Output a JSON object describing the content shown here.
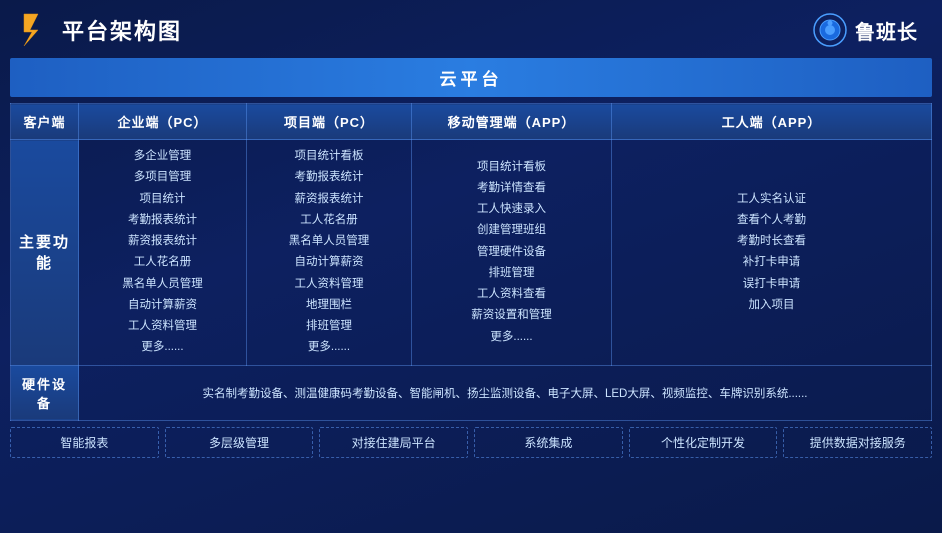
{
  "header": {
    "title": "平台架构图",
    "brand": "鲁班长"
  },
  "cloud": {
    "label": "云平台"
  },
  "columns": {
    "headers": [
      "客户端",
      "企业端（PC）",
      "项目端（PC）",
      "移动管理端（APP）",
      "工人端（APP）"
    ]
  },
  "rows": {
    "main_function_label": "主要功能",
    "enterprise_pc": [
      "多企业管理",
      "多项目管理",
      "项目统计",
      "考勤报表统计",
      "薪资报表统计",
      "工人花名册",
      "黑名单人员管理",
      "自动计算薪资",
      "工人资料管理",
      "更多......"
    ],
    "project_pc": [
      "项目统计看板",
      "考勤报表统计",
      "薪资报表统计",
      "工人花名册",
      "黑名单人员管理",
      "自动计算薪资",
      "工人资料管理",
      "地理围栏",
      "排班管理",
      "更多......"
    ],
    "mobile_app": [
      "项目统计看板",
      "考勤详情查看",
      "工人快速录入",
      "创建管理班组",
      "管理硬件设备",
      "排班管理",
      "工人资料查看",
      "薪资设置和管理",
      "更多......"
    ],
    "worker_app": [
      "工人实名认证",
      "查看个人考勤",
      "考勤时长查看",
      "补打卡申请",
      "误打卡申请",
      "加入项目"
    ]
  },
  "hardware": {
    "label": "硬件设备",
    "content": "实名制考勤设备、测温健康码考勤设备、智能闸机、扬尘监测设备、电子大屏、LED大屏、视频监控、车牌识别系统......"
  },
  "features": [
    "智能报表",
    "多层级管理",
    "对接住建局平台",
    "系统集成",
    "个性化定制开发",
    "提供数据对接服务"
  ]
}
